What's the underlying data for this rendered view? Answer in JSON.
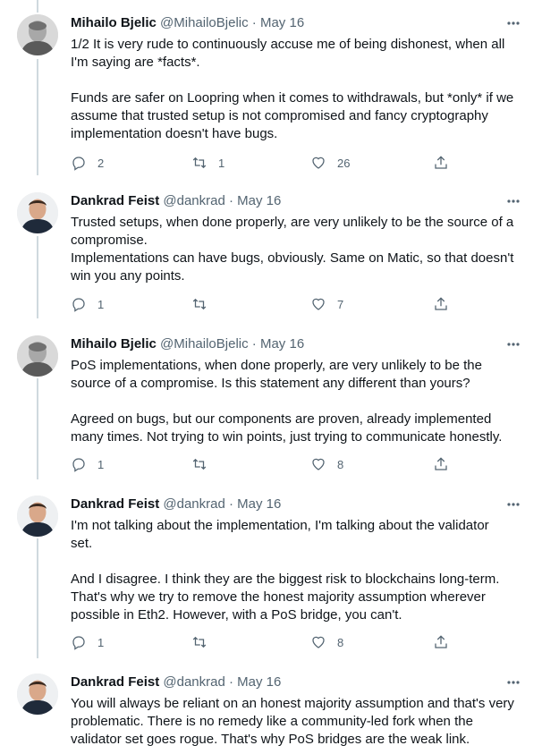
{
  "tweets": [
    {
      "name": "Mihailo Bjelic",
      "handle": "@MihailoBjelic",
      "dot": "·",
      "date": "May 16",
      "avatar_icon": "avatar-mihailo",
      "text": "1/2 It is very rude to continuously accuse me of being dishonest, when all\nI'm saying are *facts*.\n\nFunds are safer on Loopring when it comes to withdrawals, but *only* if we\nassume that trusted setup is not compromised and fancy cryptography\nimplementation doesn't have bugs.",
      "replies": "2",
      "retweets": "1",
      "likes": "26"
    },
    {
      "name": "Dankrad Feist",
      "handle": "@dankrad",
      "dot": "·",
      "date": "May 16",
      "avatar_icon": "avatar-dankrad",
      "text": "Trusted setups, when done properly, are very unlikely to be the source of a\ncompromise.\nImplementations can have bugs, obviously. Same on Matic, so that doesn't\nwin you any points.",
      "replies": "1",
      "retweets": "",
      "likes": "7"
    },
    {
      "name": "Mihailo Bjelic",
      "handle": "@MihailoBjelic",
      "dot": "·",
      "date": "May 16",
      "avatar_icon": "avatar-mihailo",
      "text": "PoS implementations, when done properly, are very unlikely to be the\nsource of a compromise. Is this statement any different than yours?\n\nAgreed on bugs, but our components are proven, already implemented\nmany times. Not trying to win points, just trying to communicate honestly.",
      "replies": "1",
      "retweets": "",
      "likes": "8"
    },
    {
      "name": "Dankrad Feist",
      "handle": "@dankrad",
      "dot": "·",
      "date": "May 16",
      "avatar_icon": "avatar-dankrad",
      "text": "I'm not talking about the implementation, I'm talking about the validator\nset.\n\nAnd I disagree. I think they are the biggest risk to blockchains long-term.\nThat's why we try to remove the honest majority assumption wherever\npossible in Eth2. However, with a PoS bridge, you can't.",
      "replies": "1",
      "retweets": "",
      "likes": "8"
    },
    {
      "name": "Dankrad Feist",
      "handle": "@dankrad",
      "dot": "·",
      "date": "May 16",
      "avatar_icon": "avatar-dankrad",
      "text": "You will always be reliant on an honest majority assumption and that's very\nproblematic. There is no remedy like a community-led fork when the\nvalidator set goes rogue. That's why PoS bridges are the weak link.",
      "replies": "",
      "retweets": "",
      "likes": ""
    }
  ]
}
